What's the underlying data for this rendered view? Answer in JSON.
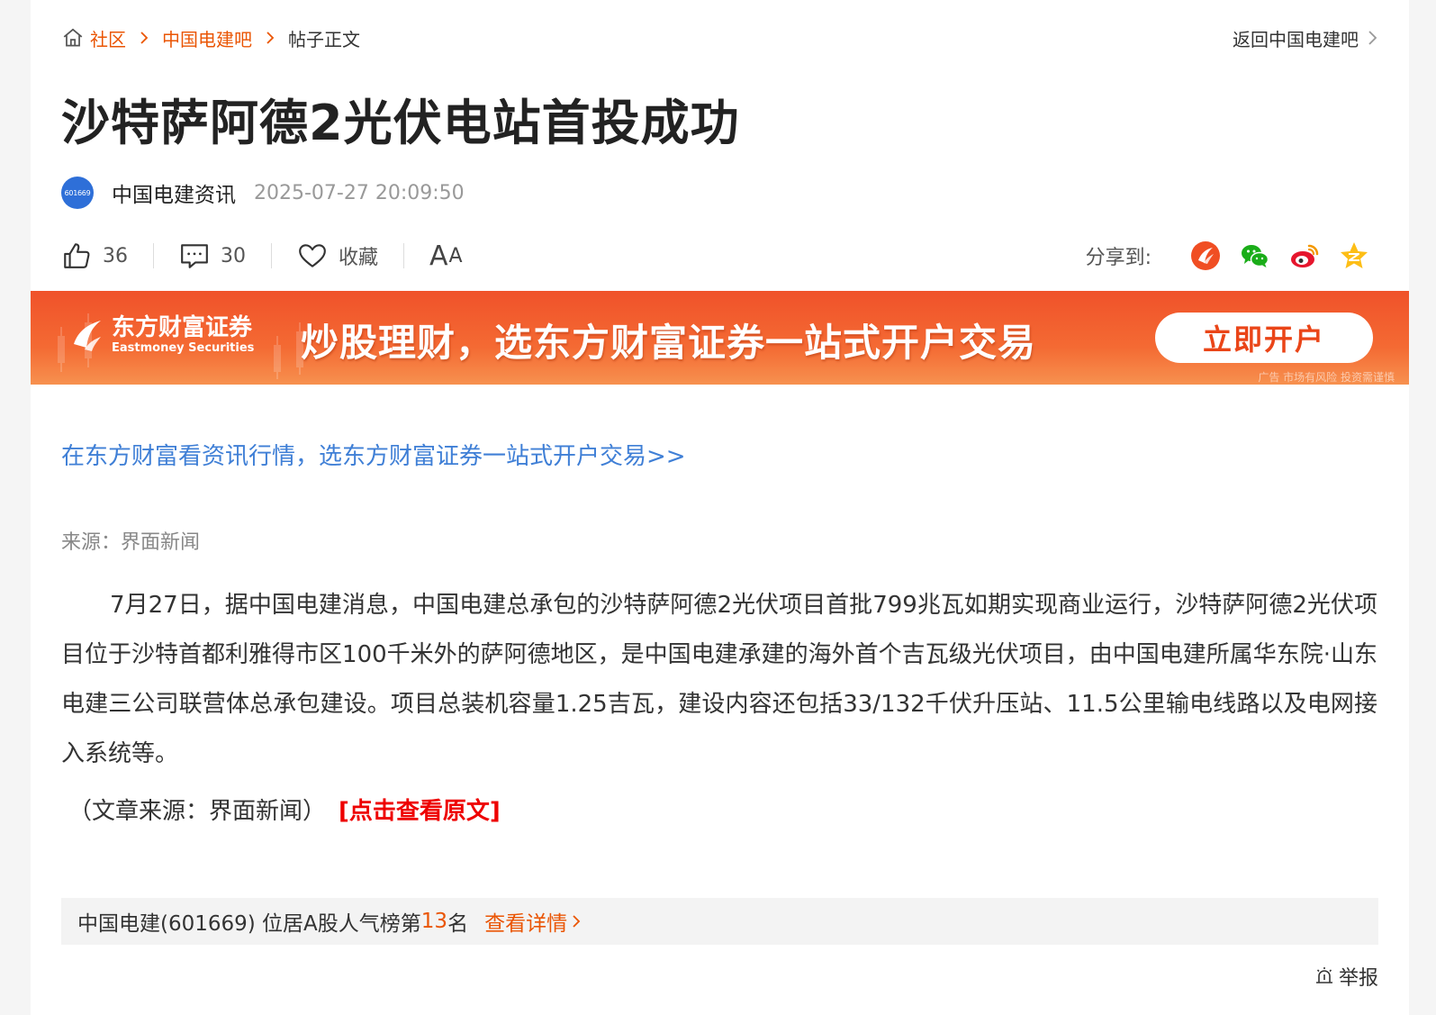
{
  "breadcrumb": {
    "items": [
      {
        "label": "社区"
      },
      {
        "label": "中国电建吧"
      },
      {
        "label": "帖子正文"
      }
    ],
    "back_label": "返回中国电建吧"
  },
  "post": {
    "title": "沙特萨阿德2光伏电站首投成功",
    "author": "中国电建资讯",
    "avatar_text": "601669",
    "time": "2025-07-27 20:09:50"
  },
  "actions": {
    "likes": "36",
    "comments": "30",
    "favorite_label": "收藏",
    "font_size_label": "A",
    "font_size_small": "A"
  },
  "share": {
    "label": "分享到:",
    "icons": [
      "eastmoney-icon",
      "wechat-icon",
      "weibo-icon",
      "qzone-icon"
    ]
  },
  "banner": {
    "logo_cn": "东方财富证券",
    "logo_en": "Eastmoney Securities",
    "text": "炒股理财，选东方财富证券一站式开户交易",
    "button": "立即开户",
    "note": "广告 市场有风险 投资需谨慎"
  },
  "promo_link": "在东方财富看资讯行情，选东方财富证券一站式开户交易>>",
  "source": "来源：界面新闻",
  "body": "7月27日，据中国电建消息，中国电建总承包的沙特萨阿德2光伏项目首批799兆瓦如期实现商业运行，沙特萨阿德2光伏项目位于沙特首都利雅得市区100千米外的萨阿德地区，是中国电建承建的海外首个吉瓦级光伏项目，由中国电建所属华东院·山东电建三公司联营体总承包建设。项目总装机容量1.25吉瓦，建设内容还包括33/132千伏升压站、11.5公里输电线路以及电网接入系统等。",
  "reference": {
    "text": "（文章来源：界面新闻）",
    "link": "[点击查看原文]"
  },
  "rank": {
    "prefix": "中国电建(601669) 位居A股人气榜第",
    "number": "13",
    "suffix": "名",
    "more": "查看详情"
  },
  "report_label": "举报",
  "colors": {
    "accent": "#ea5504",
    "link_blue": "#3f7fd6",
    "banner": "#f0522a",
    "original_link": "#ee0000"
  }
}
